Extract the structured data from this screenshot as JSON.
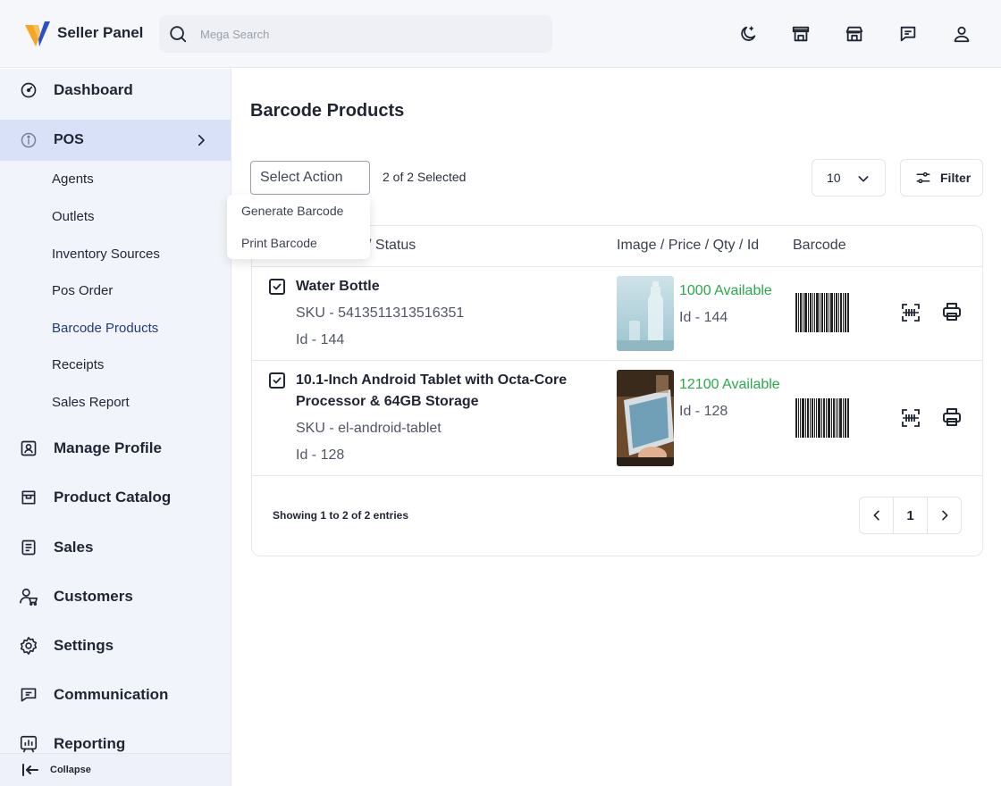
{
  "header": {
    "brand": "Seller Panel",
    "search_placeholder": "Mega Search",
    "icons": [
      "moon-star-icon",
      "store-icon",
      "shop-icon",
      "chat-icon",
      "user-icon"
    ]
  },
  "sidebar": {
    "items": [
      {
        "label": "Dashboard",
        "icon": "gauge-icon"
      },
      {
        "label": "POS",
        "icon": "info-icon"
      },
      {
        "label": "Manage Profile",
        "icon": "profile-icon"
      },
      {
        "label": "Product Catalog",
        "icon": "catalog-icon"
      },
      {
        "label": "Sales",
        "icon": "document-icon"
      },
      {
        "label": "Customers",
        "icon": "customers-icon"
      },
      {
        "label": "Settings",
        "icon": "gear-icon"
      },
      {
        "label": "Communication",
        "icon": "chat-icon"
      },
      {
        "label": "Reporting",
        "icon": "chart-icon"
      }
    ],
    "pos_submenu": [
      "Agents",
      "Outlets",
      "Inventory Sources",
      "Pos Order",
      "Barcode Products",
      "Receipts",
      "Sales Report"
    ],
    "collapse_label": "Collapse"
  },
  "main": {
    "title": "Barcode Products",
    "select_action": "Select Action",
    "selected_count": "2 of 2 Selected",
    "page_size": "10",
    "filter_label": "Filter",
    "dropdown": [
      "Generate Barcode",
      "Print Barcode"
    ],
    "columns": {
      "name": "U / Status",
      "image": "Image / Price / Qty / Id",
      "barcode": "Barcode"
    },
    "rows": [
      {
        "name": "Water Bottle",
        "sku": "SKU - 5413511313516351",
        "id": "Id - 144",
        "available": "1000 Available",
        "pid": "Id - 144"
      },
      {
        "name_line1": "10.1-Inch Android Tablet with Octa-Core",
        "name_line2": "Processor & 64GB Storage",
        "sku": "SKU - el-android-tablet",
        "id": "Id - 128",
        "available": "12100 Available",
        "pid": "Id - 128"
      }
    ],
    "showing": "Showing 1 to 2 of 2 entries",
    "current_page": "1"
  },
  "colors": {
    "accent": "#2aa84a",
    "active_nav": "#d9e1f8",
    "logo_orange": "#f5a623",
    "logo_blue": "#2b4fc7"
  }
}
